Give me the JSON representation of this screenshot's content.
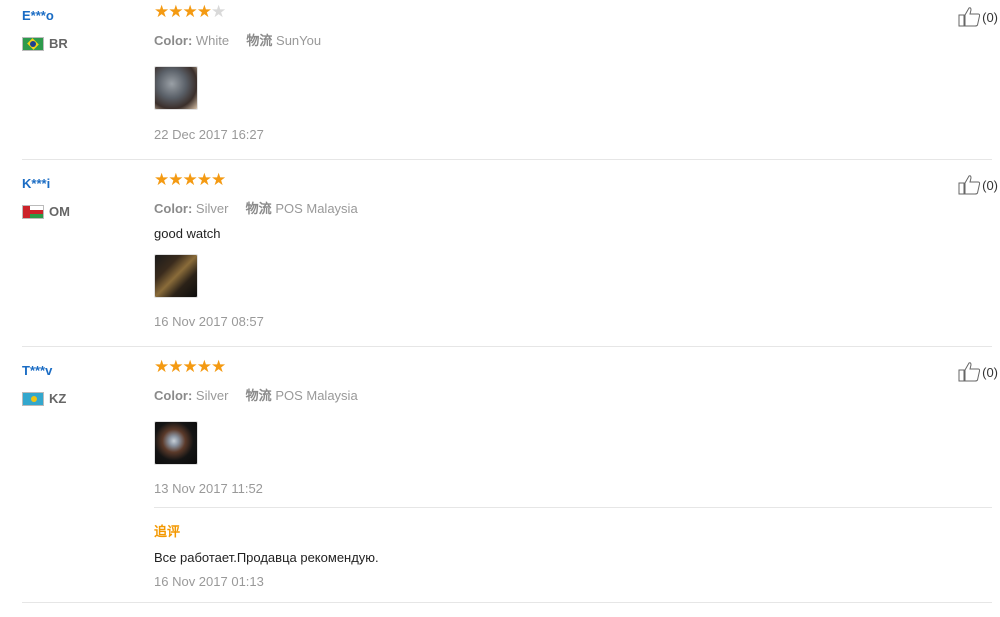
{
  "reviews": [
    {
      "name": "E***o",
      "country": "BR",
      "flag_icon": "brazil-flag-icon",
      "rating": 4,
      "color_label": "Color:",
      "color_value": "White",
      "logistics_label": "物流",
      "logistics_value": "SunYou",
      "text": "",
      "date": "22 Dec 2017 16:27",
      "likes": "(0)"
    },
    {
      "name": "K***i",
      "country": "OM",
      "flag_icon": "oman-flag-icon",
      "rating": 5,
      "color_label": "Color:",
      "color_value": "Silver",
      "logistics_label": "物流",
      "logistics_value": "POS Malaysia",
      "text": "good watch",
      "date": "16 Nov 2017 08:57",
      "likes": "(0)"
    },
    {
      "name": "T***v",
      "country": "KZ",
      "flag_icon": "kazakhstan-flag-icon",
      "rating": 5,
      "color_label": "Color:",
      "color_value": "Silver",
      "logistics_label": "物流",
      "logistics_value": "POS Malaysia",
      "text": "",
      "date": "13 Nov 2017 11:52",
      "likes": "(0)",
      "followup": {
        "label": "追评",
        "text": "Все работает.Продавца рекомендую.",
        "date": "16 Nov 2017 01:13"
      }
    }
  ],
  "icons": {
    "star": "star-icon",
    "like": "thumbs-up-icon"
  },
  "colors": {
    "name_link": "#1a6cc4",
    "star_active": "#f49a12",
    "followup_label": "#f39800"
  }
}
